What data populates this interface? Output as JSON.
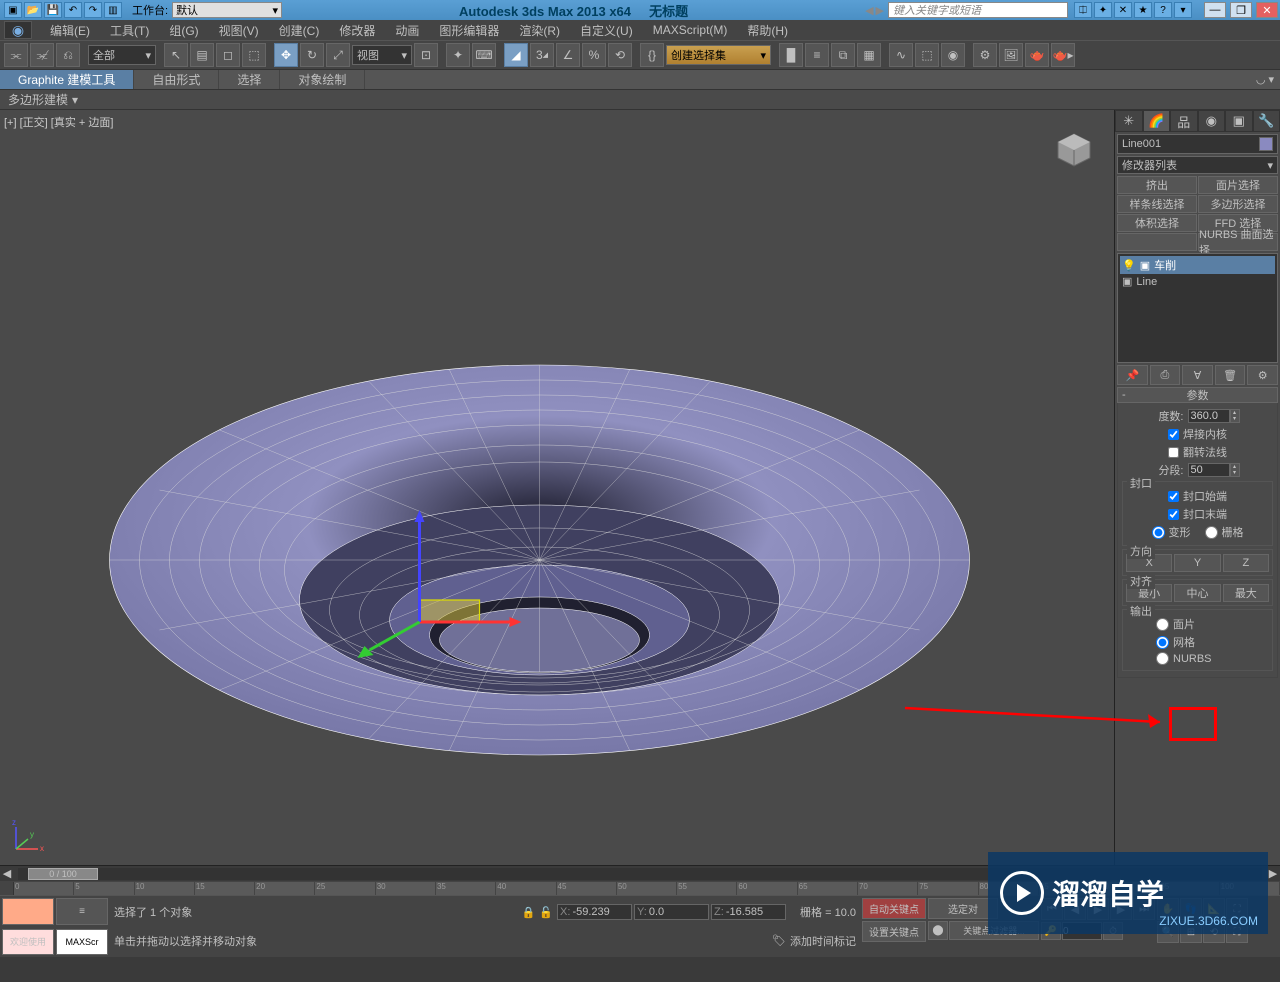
{
  "title": {
    "app": "Autodesk 3ds Max  2013 x64",
    "doc": "无标题",
    "workspace_label": "工作台:",
    "workspace_value": "默认",
    "search_placeholder": "键入关键字或短语"
  },
  "menu": [
    "编辑(E)",
    "工具(T)",
    "组(G)",
    "视图(V)",
    "创建(C)",
    "修改器",
    "动画",
    "图形编辑器",
    "渲染(R)",
    "自定义(U)",
    "MAXScript(M)",
    "帮助(H)"
  ],
  "toolbar": {
    "filter": "全部",
    "refcoord": "视图",
    "selset": "创建选择集"
  },
  "ribbon": {
    "tabs": [
      "Graphite 建模工具",
      "自由形式",
      "选择",
      "对象绘制"
    ],
    "active": 0,
    "sub": "多边形建模"
  },
  "viewport": {
    "label": "[+] [正交] [真实 + 边面]"
  },
  "cmd": {
    "obj_name": "Line001",
    "mod_list": "修改器列表",
    "btns": [
      "挤出",
      "面片选择",
      "样条线选择",
      "多边形选择",
      "体积选择",
      "FFD 选择",
      "",
      "NURBS 曲面选择"
    ],
    "stack": [
      {
        "eye": "💡",
        "txt": "车削",
        "sel": true
      },
      {
        "eye": "▣",
        "txt": "Line",
        "sel": false
      }
    ],
    "params_title": "参数",
    "degrees_label": "度数:",
    "degrees_value": "360.0",
    "weld_core": "焊接内核",
    "weld_core_checked": true,
    "flip_normals": "翻转法线",
    "flip_normals_checked": false,
    "segments_label": "分段:",
    "segments_value": "50",
    "capping_title": "封口",
    "cap_start": "封口始端",
    "cap_start_checked": true,
    "cap_end": "封口末端",
    "cap_end_checked": true,
    "morph": "变形",
    "grid": "栅格",
    "direction_title": "方向",
    "align_title": "对齐",
    "align_min": "最小",
    "align_center": "中心",
    "align_max": "最大",
    "output_title": "输出",
    "out_patch": "面片",
    "out_mesh": "网格",
    "out_nurbs": "NURBS"
  },
  "time": {
    "frame": "0 / 100"
  },
  "status": {
    "sel": "选择了 1 个对象",
    "welcome": "欢迎使用",
    "script": "MAXScr",
    "prompt": "单击并拖动以选择并移动对象",
    "x": "-59.239",
    "y": "0.0",
    "z": "-16.585",
    "grid": "栅格 = 10.0",
    "addtime": "添加时间标记",
    "autokey": "自动关键点",
    "selset2": "选定对",
    "setkey": "设置关键点",
    "keyfilter": "关键点过滤器..."
  },
  "watermark": {
    "t1": "溜溜自学",
    "t2": "ZIXUE.3D66.COM"
  }
}
